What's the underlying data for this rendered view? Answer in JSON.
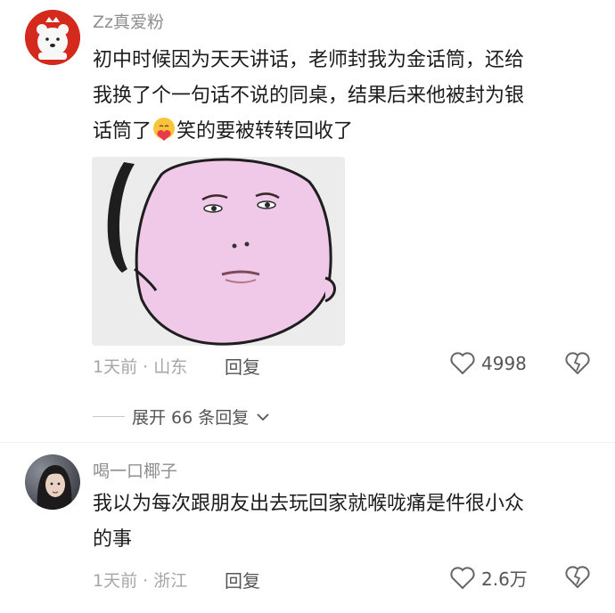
{
  "comments": [
    {
      "username": "Zz真爱粉",
      "lines": [
        "初中时候因为天天讲话，老师封我为金话筒，还给",
        "我换了个一句话不说的同桌，结果后来他被封为银",
        "话筒了",
        "笑的要被转转回收了"
      ],
      "time_location": "1天前 · 山东",
      "reply_label": "回复",
      "like_count": "4998",
      "expand_label": "展开 66 条回复"
    },
    {
      "username": "喝一口椰子",
      "lines": [
        "我以为每次跟朋友出去玩回家就喉咙痛是件很小众",
        "的事"
      ],
      "time_location": "1天前 · 浙江",
      "reply_label": "回复",
      "like_count": "2.6万"
    }
  ],
  "colors": {
    "avatar_red": "#d42a1e",
    "meta_gray": "#a6a6a6",
    "text": "#1c1c1c"
  }
}
